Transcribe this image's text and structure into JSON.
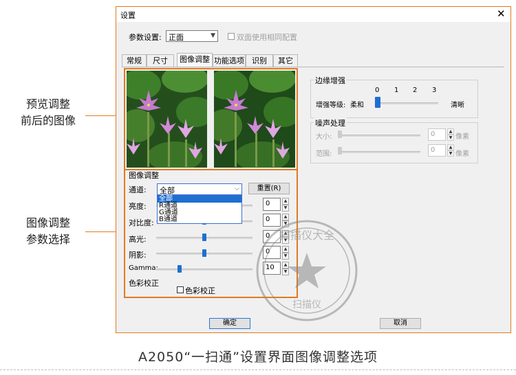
{
  "annotations": {
    "preview_line1": "预览调整",
    "preview_line2": "前后的图像",
    "adjust_line1": "图像调整",
    "adjust_line2": "参数选择"
  },
  "window": {
    "title": "设置",
    "close_glyph": "✕",
    "param_label": "参数设置:",
    "param_value": "正面",
    "duplex_label": "双面使用相同配置"
  },
  "tabs": [
    {
      "label": "常规"
    },
    {
      "label": "尺寸"
    },
    {
      "label": "图像调整"
    },
    {
      "label": "功能选项"
    },
    {
      "label": "识别"
    },
    {
      "label": "其它"
    }
  ],
  "image_adjust": {
    "group_title": "图像调整",
    "channel_label": "通道:",
    "channel_value": "全部",
    "reset_label": "重置(R)",
    "channel_options": [
      "全部",
      "R通道",
      "G通道",
      "B通道"
    ],
    "sliders": [
      {
        "label": "亮度:",
        "value": "0",
        "level": 0.5
      },
      {
        "label": "对比度:",
        "value": "0",
        "level": 0.5
      },
      {
        "label": "高光:",
        "value": "0",
        "level": 0.5
      },
      {
        "label": "阴影:",
        "value": "0",
        "level": 0.5
      },
      {
        "label": "Gamma:",
        "value": "10",
        "level": 0.24
      }
    ],
    "color_section": "色彩校正",
    "color_checkbox": "色彩校正"
  },
  "edge": {
    "group_title": "边缘增强",
    "level_label": "增强等级:",
    "soft": "柔和",
    "sharp": "清晰",
    "ticks": [
      "0",
      "1",
      "2",
      "3"
    ],
    "level": 0
  },
  "noise": {
    "group_title": "噪声处理",
    "size_label": "大小:",
    "size_value": "0",
    "size_unit": "像素",
    "range_label": "范围:",
    "range_value": "0",
    "range_unit": "像素"
  },
  "buttons": {
    "ok": "确定",
    "cancel": "取消"
  },
  "stamp": {
    "text_arc": "扫描仪大全",
    "text_bottom": "扫描仪"
  },
  "caption": "A2050“一扫通”设置界面图像调整选项",
  "colors": {
    "accent_orange": "#e07a1f",
    "selection_blue": "#1e6fd1"
  }
}
